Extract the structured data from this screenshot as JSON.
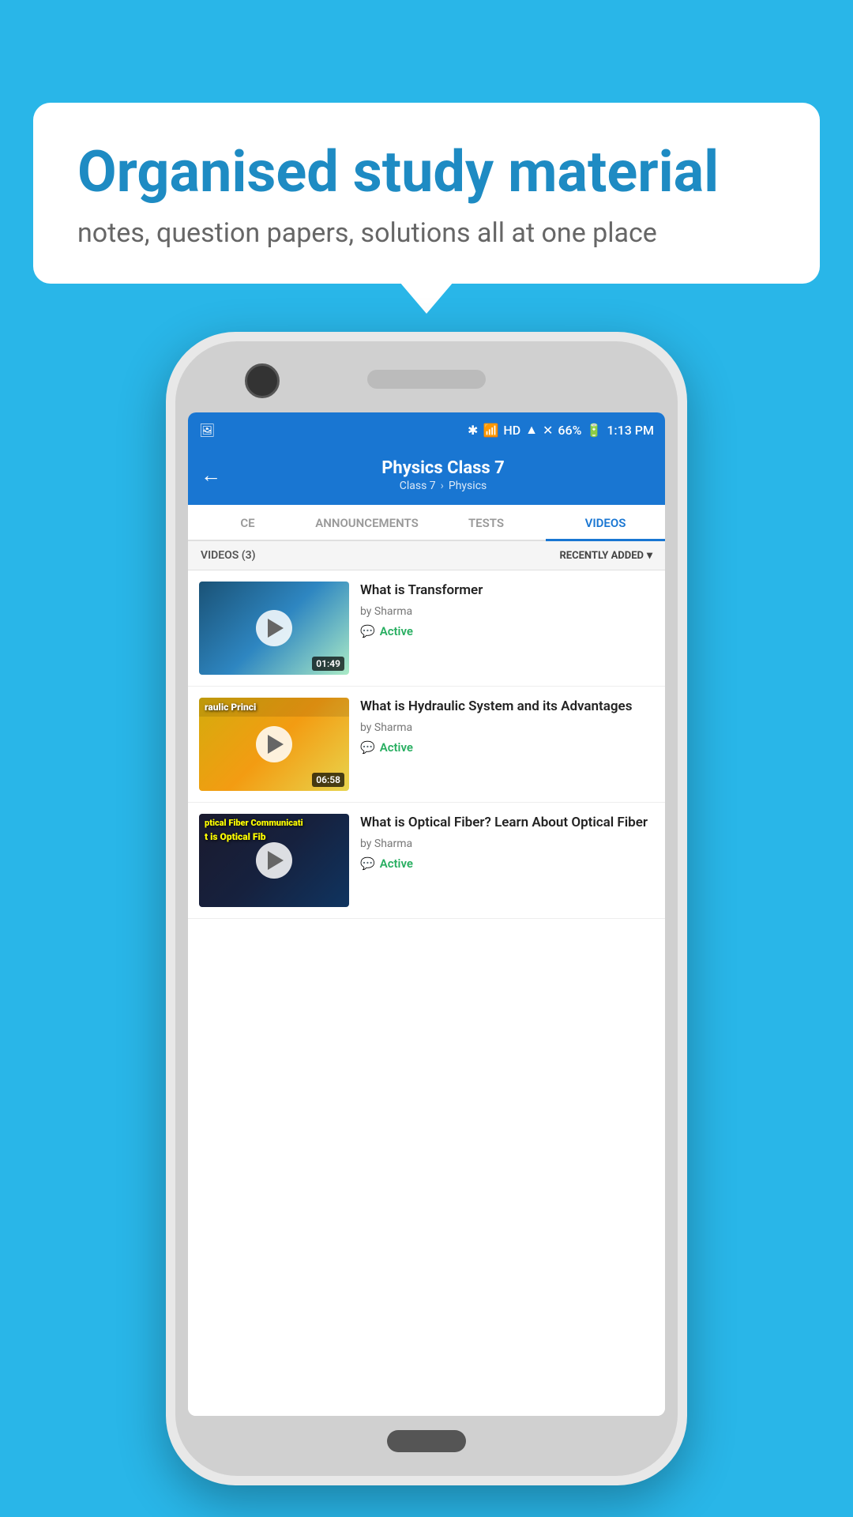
{
  "background_color": "#29b6e8",
  "bubble": {
    "title": "Organised study material",
    "subtitle": "notes, question papers, solutions all at one place"
  },
  "status_bar": {
    "battery": "66%",
    "time": "1:13 PM",
    "signal_icons": "HD"
  },
  "header": {
    "title": "Physics Class 7",
    "breadcrumb_class": "Class 7",
    "breadcrumb_subject": "Physics",
    "back_label": "←"
  },
  "tabs": [
    {
      "label": "CE",
      "active": false
    },
    {
      "label": "ANNOUNCEMENTS",
      "active": false
    },
    {
      "label": "TESTS",
      "active": false
    },
    {
      "label": "VIDEOS",
      "active": true
    }
  ],
  "filter": {
    "count_label": "VIDEOS (3)",
    "sort_label": "RECENTLY ADDED",
    "sort_arrow": "▾"
  },
  "videos": [
    {
      "title": "What is  Transformer",
      "author": "by Sharma",
      "duration": "01:49",
      "status": "Active",
      "thumb_type": "transformer",
      "thumb_overlay_text": ""
    },
    {
      "title": "What is Hydraulic System and its Advantages",
      "author": "by Sharma",
      "duration": "06:58",
      "status": "Active",
      "thumb_type": "hydraulic",
      "thumb_overlay_text": "raulic Princi"
    },
    {
      "title": "What is Optical Fiber? Learn About Optical Fiber",
      "author": "by Sharma",
      "duration": "",
      "status": "Active",
      "thumb_type": "optical",
      "thumb_overlay_text": "ptical Fiber Communicati"
    }
  ],
  "icons": {
    "play": "▶",
    "back": "←",
    "chat": "💬",
    "chevron_down": "▾"
  }
}
